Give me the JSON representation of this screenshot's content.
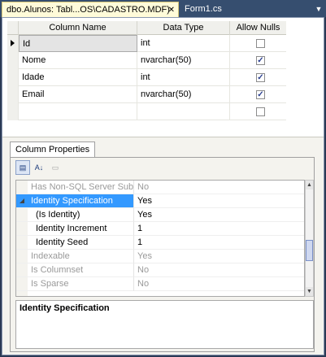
{
  "tabs": [
    {
      "label": "dbo.Alunos: Tabl...OS\\CADASTRO.MDF)",
      "active": true
    },
    {
      "label": "Form1.cs",
      "active": false
    }
  ],
  "grid": {
    "headers": [
      "Column Name",
      "Data Type",
      "Allow Nulls"
    ],
    "rows": [
      {
        "name": "Id",
        "type": "int",
        "allow_nulls": false,
        "selected": true
      },
      {
        "name": "Nome",
        "type": "nvarchar(50)",
        "allow_nulls": true
      },
      {
        "name": "Idade",
        "type": "int",
        "allow_nulls": true
      },
      {
        "name": "Email",
        "type": "nvarchar(50)",
        "allow_nulls": true
      },
      {
        "name": "",
        "type": "",
        "allow_nulls": false
      }
    ]
  },
  "column_properties": {
    "tab_label": "Column Properties",
    "properties": [
      {
        "name": "Has Non-SQL Server Subscr",
        "value": "No",
        "disabled": true
      },
      {
        "name": "Identity Specification",
        "value": "Yes",
        "highlighted": true,
        "expanded": true
      },
      {
        "name": "(Is Identity)",
        "value": "Yes"
      },
      {
        "name": "Identity Increment",
        "value": "1"
      },
      {
        "name": "Identity Seed",
        "value": "1"
      },
      {
        "name": "Indexable",
        "value": "Yes",
        "disabled": true
      },
      {
        "name": "Is Columnset",
        "value": "No",
        "disabled": true
      },
      {
        "name": "Is Sparse",
        "value": "No",
        "disabled": true
      }
    ],
    "description_title": "Identity Specification"
  },
  "colors": {
    "tab_strip": "#364e6f",
    "active_tab": "#fffbd9",
    "highlight": "#3399ff"
  }
}
